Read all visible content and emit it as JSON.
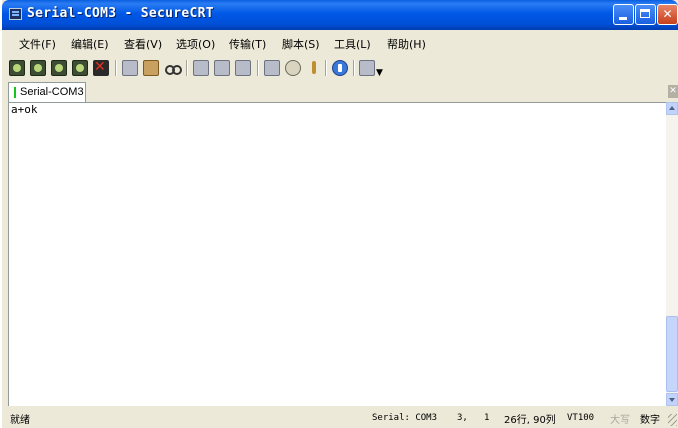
{
  "window": {
    "title": "Serial-COM3 - SecureCRT"
  },
  "menu": {
    "items": [
      "文件(F)",
      "编辑(E)",
      "查看(V)",
      "选项(O)",
      "传输(T)",
      "脚本(S)",
      "工具(L)",
      "帮助(H)"
    ]
  },
  "toolbar": {
    "icons": [
      "connect-icon",
      "quick-connect-icon",
      "connect-in-tab-icon",
      "reconnect-icon",
      "disconnect-icon",
      "copy-icon",
      "paste-icon",
      "find-icon",
      "print-setup-icon",
      "print-selection-icon",
      "print-icon",
      "session-options-icon",
      "global-options-icon",
      "key-map-icon",
      "help-icon",
      "sftp-icon"
    ]
  },
  "tabs": [
    {
      "label": "Serial-COM3",
      "status_color": "#19c419",
      "active": true
    }
  ],
  "terminal": {
    "lines": [
      "a+ok"
    ]
  },
  "status": {
    "ready": "就绪",
    "connection": "Serial: COM3",
    "row": "3,",
    "col": "1",
    "size": "26行, 90列",
    "emulation": "VT100",
    "caps": "大写",
    "num": "数字"
  },
  "colors": {
    "title_bar": "#0058e6",
    "close_button": "#d4582e",
    "chrome": "#ece9d8"
  }
}
